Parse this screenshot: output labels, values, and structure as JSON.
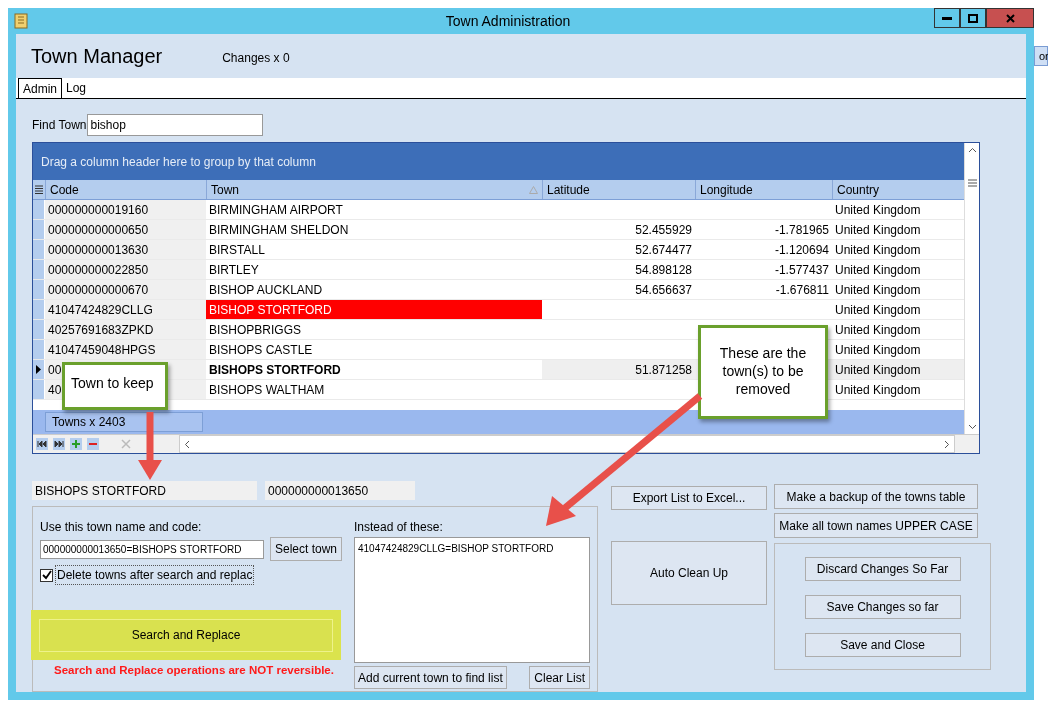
{
  "window": {
    "title": "Town Administration"
  },
  "background_button": {
    "label": "or"
  },
  "header": {
    "title": "Town Manager",
    "changes": "Changes x 0"
  },
  "tabs": [
    {
      "label": "Admin",
      "selected": true
    },
    {
      "label": "Log",
      "selected": false
    }
  ],
  "find_town": {
    "label": "Find Town",
    "value": "bishop"
  },
  "grid": {
    "group_hint": "Drag a column header here to group by that column",
    "columns": [
      {
        "label": "Code",
        "sorted": false
      },
      {
        "label": "Town",
        "sorted": true
      },
      {
        "label": "Latitude",
        "sorted": false
      },
      {
        "label": "Longitude",
        "sorted": false
      },
      {
        "label": "Country",
        "sorted": false
      }
    ],
    "rows": [
      {
        "code": "000000000019160",
        "town": "BIRMINGHAM AIRPORT",
        "latitude": "",
        "longitude": "",
        "country": "United Kingdom",
        "selected": false,
        "flagged": false
      },
      {
        "code": "000000000000650",
        "town": "BIRMINGHAM SHELDON",
        "latitude": "52.455929",
        "longitude": "-1.781965",
        "country": "United Kingdom",
        "selected": false,
        "flagged": false
      },
      {
        "code": "000000000013630",
        "town": "BIRSTALL",
        "latitude": "52.674477",
        "longitude": "-1.120694",
        "country": "United Kingdom",
        "selected": false,
        "flagged": false
      },
      {
        "code": "000000000022850",
        "town": "BIRTLEY",
        "latitude": "54.898128",
        "longitude": "-1.577437",
        "country": "United Kingdom",
        "selected": false,
        "flagged": false
      },
      {
        "code": "000000000000670",
        "town": "BISHOP AUCKLAND",
        "latitude": "54.656637",
        "longitude": "-1.676811",
        "country": "United Kingdom",
        "selected": false,
        "flagged": false
      },
      {
        "code": "41047424829CLLG",
        "town": "BISHOP STORTFORD",
        "latitude": "",
        "longitude": "",
        "country": "United Kingdom",
        "selected": false,
        "flagged": true
      },
      {
        "code": "40257691683ZPKD",
        "town": "BISHOPBRIGGS",
        "latitude": "",
        "longitude": "",
        "country": "United Kingdom",
        "selected": false,
        "flagged": false
      },
      {
        "code": "41047459048HPGS",
        "town": "BISHOPS CASTLE",
        "latitude": "",
        "longitude": "",
        "country": "United Kingdom",
        "selected": false,
        "flagged": false
      },
      {
        "code": "00",
        "town": "BISHOPS STORTFORD",
        "latitude": "51.871258",
        "longitude": "",
        "country": "United Kingdom",
        "selected": true,
        "flagged": false
      },
      {
        "code": "40",
        "town": "BISHOPS WALTHAM",
        "latitude": "",
        "longitude": "",
        "country": "United Kingdom",
        "selected": false,
        "flagged": false
      }
    ],
    "footer": "Towns x 2403"
  },
  "selected_town": {
    "name": "BISHOPS STORTFORD",
    "code": "000000000013650"
  },
  "replace": {
    "use_label": "Use this town name and code:",
    "use_value": "000000000013650=BISHOPS STORTFORD",
    "select_button": "Select town",
    "delete_option": {
      "label": "Delete towns after search and replac",
      "checked": true
    },
    "search_button": "Search and Replace",
    "warning": "Search and Replace operations are NOT reversible.",
    "instead_label": "Instead of these:",
    "instead_items": [
      "41047424829CLLG=BISHOP STORTFORD"
    ],
    "add_button": "Add current town to find list",
    "clear_button": "Clear List"
  },
  "actions": {
    "export": "Export List to Excel...",
    "backup": "Make a backup of the towns table",
    "upper": "Make all town names UPPER CASE",
    "auto_clean": "Auto Clean Up",
    "save_group": [
      "Discard Changes So Far",
      "Save Changes so far",
      "Save and Close"
    ]
  },
  "callouts": [
    {
      "text": "Town to keep"
    },
    {
      "text": "These are the town(s) to be removed"
    }
  ]
}
